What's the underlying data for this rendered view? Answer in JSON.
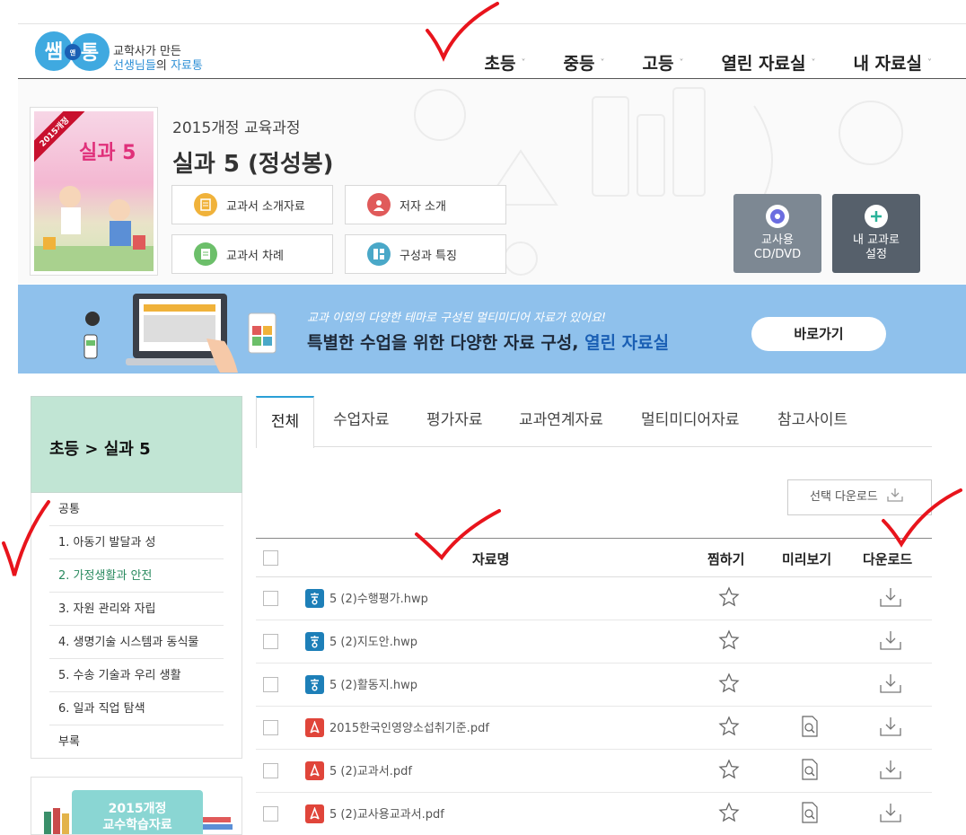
{
  "logo": {
    "mark_text": "쌤앤통",
    "line1": "교학사가 만든",
    "line2_prefix": "선생님들",
    "line2_mid": "의 ",
    "line2_suffix": "자료통"
  },
  "nav": {
    "items": [
      {
        "label": "초등"
      },
      {
        "label": "중등"
      },
      {
        "label": "고등"
      },
      {
        "label": "열린 자료실"
      },
      {
        "label": "내 자료실"
      }
    ],
    "caret": "˅"
  },
  "book": {
    "course": "2015개정 교육과정",
    "title": "실과 5 (정성봉)",
    "cover_ribbon": "2015개정",
    "cover_title": "실과 5",
    "buttons": [
      {
        "label": "교과서 소개자료",
        "icon": "document-icon",
        "color": "#f0b23a"
      },
      {
        "label": "저자 소개",
        "icon": "person-icon",
        "color": "#e05a5a"
      },
      {
        "label": "교과서 차례",
        "icon": "list-icon",
        "color": "#6cbf6a"
      },
      {
        "label": "구성과 특징",
        "icon": "layout-icon",
        "color": "#4aa8c8"
      }
    ],
    "cd_label_1": "교사용",
    "cd_label_2": "CD/DVD",
    "my_label_1": "내 교과로",
    "my_label_2": "설정"
  },
  "banner": {
    "sub": "교과 이외의 다양한 테마로 구성된 멀티미디어 자료가 있어요!",
    "main_prefix": "특별한 수업을 위한 다양한 자료 구성, ",
    "main_highlight": "열린 자료실",
    "button": "바로가기"
  },
  "sidebar": {
    "title": "초등 > 실과 5",
    "items": [
      {
        "label": "공통"
      },
      {
        "label": "1. 아동기 발달과 성"
      },
      {
        "label": "2. 가정생활과 안전"
      },
      {
        "label": "3. 자원 관리와 자립"
      },
      {
        "label": "4. 생명기술 시스템과 동식물"
      },
      {
        "label": "5. 수송 기술과 우리 생활"
      },
      {
        "label": "6. 일과 직업 탐색"
      },
      {
        "label": "부록"
      }
    ],
    "promo_line1": "2015개정",
    "promo_line2": "교수학습자료"
  },
  "tabs": [
    {
      "label": "전체"
    },
    {
      "label": "수업자료"
    },
    {
      "label": "평가자료"
    },
    {
      "label": "교과연계자료"
    },
    {
      "label": "멀티미디어자료"
    },
    {
      "label": "참고사이트"
    }
  ],
  "select_download": "선택 다운로드",
  "table": {
    "headers": {
      "name": "자료명",
      "fav": "찜하기",
      "preview": "미리보기",
      "download": "다운로드"
    },
    "rows": [
      {
        "type": "hwp",
        "name": "5 (2)수행평가.hwp",
        "preview": false
      },
      {
        "type": "hwp",
        "name": "5 (2)지도안.hwp",
        "preview": false
      },
      {
        "type": "hwp",
        "name": "5 (2)활동지.hwp",
        "preview": false
      },
      {
        "type": "pdf",
        "name": "2015한국인영양소섭취기준.pdf",
        "preview": true
      },
      {
        "type": "pdf",
        "name": "5 (2)교과서.pdf",
        "preview": true
      },
      {
        "type": "pdf",
        "name": "5 (2)교사용교과서.pdf",
        "preview": true
      }
    ]
  },
  "colors": {
    "accent": "#2a9fd6",
    "banner": "#8fc1ec",
    "sidebar_head": "#c1e5d4",
    "hwp": "#1d7fb8",
    "pdf": "#e0453a",
    "annotation": "#e8141c"
  }
}
